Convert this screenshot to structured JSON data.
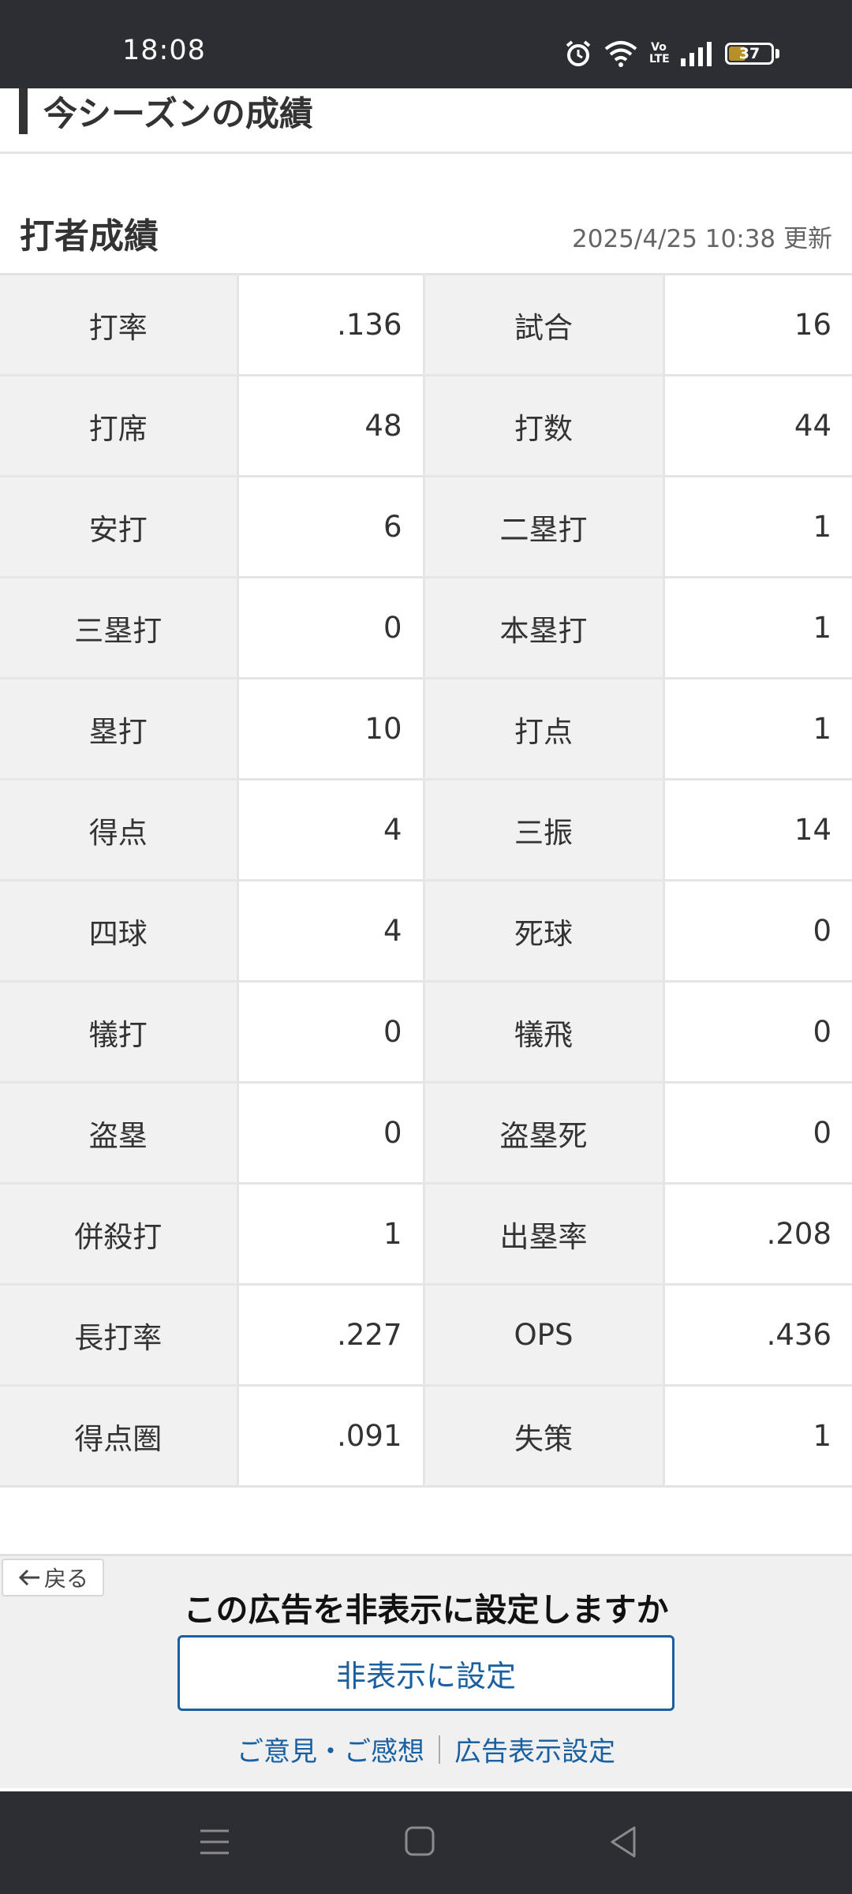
{
  "status_bar": {
    "time": "18:08",
    "battery_level": "37",
    "battery_fraction": 0.37,
    "network_label": "Vo LTE",
    "icons": [
      "alarm-icon",
      "wifi-icon",
      "volte-icon",
      "signal-icon",
      "battery-icon"
    ]
  },
  "season": {
    "title": "今シーズンの成績"
  },
  "batting": {
    "title": "打者成績",
    "updated": "2025/4/25 10:38 更新",
    "rows": [
      {
        "label1": "打率",
        "value1": ".136",
        "label2": "試合",
        "value2": "16"
      },
      {
        "label1": "打席",
        "value1": "48",
        "label2": "打数",
        "value2": "44"
      },
      {
        "label1": "安打",
        "value1": "6",
        "label2": "二塁打",
        "value2": "1"
      },
      {
        "label1": "三塁打",
        "value1": "0",
        "label2": "本塁打",
        "value2": "1"
      },
      {
        "label1": "塁打",
        "value1": "10",
        "label2": "打点",
        "value2": "1"
      },
      {
        "label1": "得点",
        "value1": "4",
        "label2": "三振",
        "value2": "14"
      },
      {
        "label1": "四球",
        "value1": "4",
        "label2": "死球",
        "value2": "0"
      },
      {
        "label1": "犠打",
        "value1": "0",
        "label2": "犠飛",
        "value2": "0"
      },
      {
        "label1": "盗塁",
        "value1": "0",
        "label2": "盗塁死",
        "value2": "0"
      },
      {
        "label1": "併殺打",
        "value1": "1",
        "label2": "出塁率",
        "value2": ".208"
      },
      {
        "label1": "長打率",
        "value1": ".227",
        "label2": "OPS",
        "value2": ".436"
      },
      {
        "label1": "得点圏",
        "value1": ".091",
        "label2": "失策",
        "value2": "1"
      }
    ]
  },
  "ad": {
    "back_label": "戻る",
    "prompt": "この広告を非表示に設定しますか",
    "hide_button": "非表示に設定",
    "feedback_link": "ご意見・ご感想",
    "settings_link": "広告表示設定"
  },
  "colors": {
    "system_bar": "#2d2e33",
    "label_cell": "#f1f1f1",
    "link_blue": "#1a5fa0",
    "battery": "#b8902a"
  }
}
